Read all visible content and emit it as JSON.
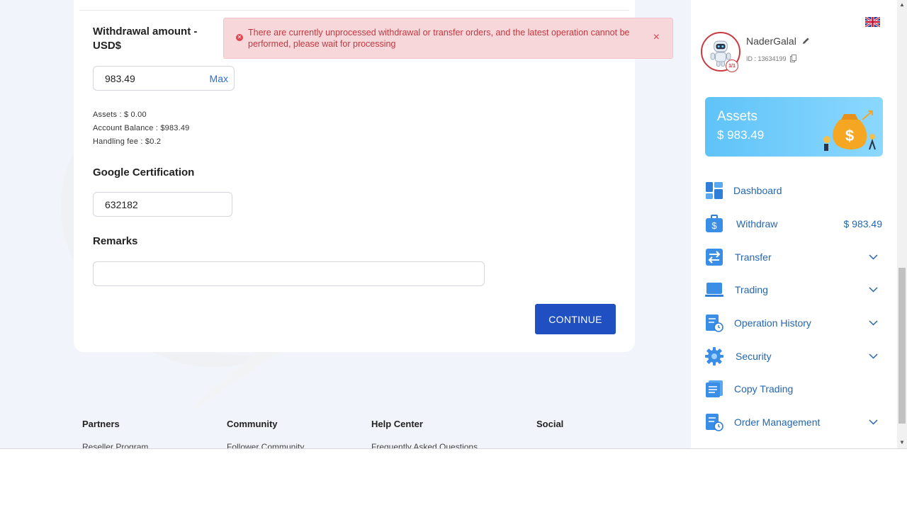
{
  "form": {
    "withdrawal_label": "Withdrawal amount - USD$",
    "amount_value": "983.49",
    "max_label": "Max",
    "assets_line": "Assets : $ 0.00",
    "balance_line": "Account Balance : $983.49",
    "fee_line": "Handling fee : $0.2",
    "google_label": "Google Certification",
    "google_value": "632182",
    "remarks_label": "Remarks",
    "remarks_value": "",
    "continue_label": "CONTINUE"
  },
  "alert": {
    "message": "There are currently unprocessed withdrawal or transfer orders, and the latest operation cannot be performed, please wait for processing",
    "close": "×",
    "icon": "error-circle-icon",
    "color": "#c0383f"
  },
  "footer": {
    "columns": [
      {
        "title": "Partners",
        "link": "Reseller Program"
      },
      {
        "title": "Community",
        "link": "Follower Community"
      },
      {
        "title": "Help Center",
        "link": "Frequently Asked Questions"
      },
      {
        "title": "Social",
        "link": ""
      }
    ]
  },
  "user": {
    "name": "NaderGalal",
    "id": "ID : 13634199",
    "badge": "1/1"
  },
  "assets_card": {
    "title": "Assets",
    "value": "$ 983.49"
  },
  "nav": {
    "dashboard": "Dashboard",
    "withdraw": "Withdraw",
    "withdraw_amount": "$ 983.49",
    "transfer": "Transfer",
    "trading": "Trading",
    "operation_history": "Operation History",
    "security": "Security",
    "copy_trading": "Copy Trading",
    "order_management": "Order Management"
  },
  "colors": {
    "primary_button": "#1f4fc0",
    "nav_text": "#2467b0",
    "assets_gradient_start": "#5fc3f8"
  }
}
